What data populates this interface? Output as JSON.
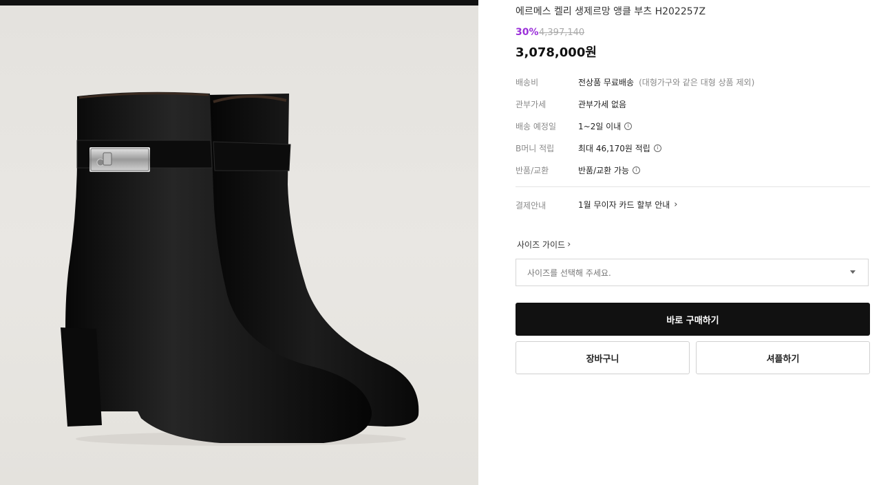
{
  "product": {
    "title": "에르메스 켈리 생제르망 앵클 부츠 H202257Z",
    "discount": "30%",
    "original_price": "4,397,140",
    "price": "3,078,000원",
    "image_alt": "ankle-boots-photo"
  },
  "info": {
    "shipping": {
      "label": "배송비",
      "value": "전상품 무료배송",
      "note": "(대형가구와 같은 대형 상품 제외)"
    },
    "customs": {
      "label": "관부가세",
      "value": "관부가세 없음"
    },
    "delivery": {
      "label": "배송 예정일",
      "value": "1~2일 이내"
    },
    "points": {
      "label": "B머니 적립",
      "value": "최대 46,170원 적립"
    },
    "returns": {
      "label": "반품/교환",
      "value": "반품/교환 가능"
    },
    "payment": {
      "label": "결제안내",
      "value": "1월 무이자 카드 할부 안내"
    }
  },
  "size": {
    "guide_label": "사이즈 가이드",
    "placeholder": "사이즈를 선택해 주세요."
  },
  "actions": {
    "buy_now": "바로 구매하기",
    "cart": "장바구니",
    "share": "셔플하기"
  },
  "icons": {
    "info": "info-circle-icon",
    "chevron": "chevron-right-icon",
    "caret": "caret-down-icon"
  },
  "colors": {
    "discount": "#9b30d9",
    "primary_button": "#111111"
  }
}
